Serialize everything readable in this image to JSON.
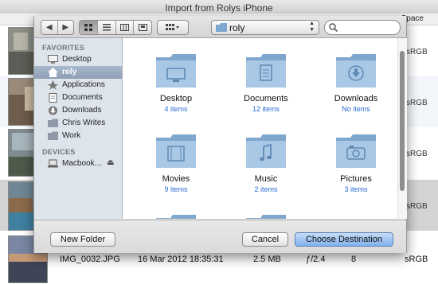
{
  "window": {
    "title": "Import from Rolys iPhone"
  },
  "background": {
    "column_header_right": "Space",
    "row_color_space": "sRGB",
    "bottom_row": {
      "filename": "IMG_0032.JPG",
      "date": "16 Mar 2012 18:35:31",
      "size": "2.5 MB",
      "aperture": "ƒ/2.4",
      "count": "8",
      "color_space": "sRGB"
    }
  },
  "toolbar": {
    "back_icon": "chevron-left-icon",
    "forward_icon": "chevron-right-icon",
    "view_modes": [
      "icon-view-icon",
      "list-view-icon",
      "column-view-icon",
      "coverflow-view-icon"
    ],
    "arrange_icon": "grid-arrange-icon",
    "location": "roly",
    "search_placeholder": ""
  },
  "sidebar": {
    "favorites_heading": "FAVORITES",
    "favorites": [
      {
        "label": "Desktop",
        "icon": "desktop-icon"
      },
      {
        "label": "roly",
        "icon": "home-icon",
        "selected": true
      },
      {
        "label": "Applications",
        "icon": "applications-icon"
      },
      {
        "label": "Documents",
        "icon": "documents-icon"
      },
      {
        "label": "Downloads",
        "icon": "downloads-icon"
      },
      {
        "label": "Chris Writes",
        "icon": "folder-icon"
      },
      {
        "label": "Work",
        "icon": "folder-icon"
      }
    ],
    "devices_heading": "DEVICES",
    "devices": [
      {
        "label": "Macbook…",
        "icon": "laptop-icon"
      }
    ]
  },
  "folders": [
    {
      "name": "Desktop",
      "count": "4 items"
    },
    {
      "name": "Documents",
      "count": "12 items"
    },
    {
      "name": "Downloads",
      "count": "No items"
    },
    {
      "name": "Movies",
      "count": "9 items"
    },
    {
      "name": "Music",
      "count": "2 items"
    },
    {
      "name": "Pictures",
      "count": "3 items"
    }
  ],
  "buttons": {
    "new_folder": "New Folder",
    "cancel": "Cancel",
    "choose": "Choose Destination"
  },
  "colors": {
    "accent": "#2a6bd0",
    "folder": "#9bbfdf",
    "sidebar": "#dde4ec"
  }
}
